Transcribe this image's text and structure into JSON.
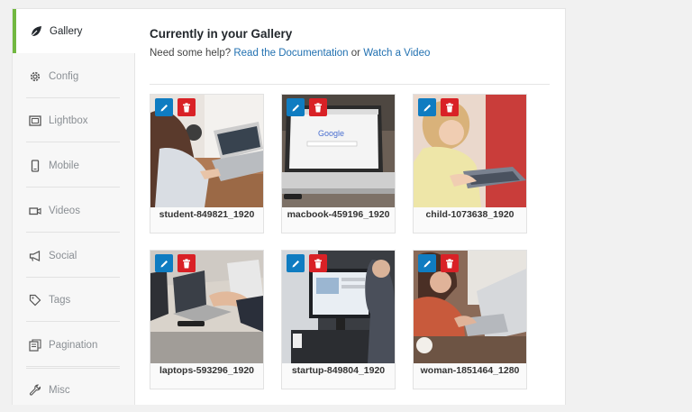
{
  "sidebar": {
    "items": [
      {
        "label": "Gallery",
        "icon": "leaf-icon",
        "active": true
      },
      {
        "label": "Config",
        "icon": "gear-icon"
      },
      {
        "label": "Lightbox",
        "icon": "lightbox-icon"
      },
      {
        "label": "Mobile",
        "icon": "mobile-icon"
      },
      {
        "label": "Videos",
        "icon": "video-camera-icon"
      },
      {
        "label": "Social",
        "icon": "megaphone-icon"
      },
      {
        "label": "Tags",
        "icon": "tag-icon"
      },
      {
        "label": "Pagination",
        "icon": "pagination-icon"
      },
      {
        "label": "Misc",
        "icon": "wrench-icon"
      }
    ]
  },
  "main": {
    "title": "Currently in your Gallery",
    "help_prefix": "Need some help?",
    "doc_link": "Read the Documentation",
    "help_or": "or",
    "video_link": "Watch a Video"
  },
  "images": [
    {
      "caption": "student-849821_1920"
    },
    {
      "caption": "macbook-459196_1920"
    },
    {
      "caption": "child-1073638_1920"
    },
    {
      "caption": "laptops-593296_1920"
    },
    {
      "caption": "startup-849804_1920"
    },
    {
      "caption": "woman-1851464_1280"
    }
  ],
  "colors": {
    "accent": "#72b841",
    "edit": "#0f7cc1",
    "delete": "#d92126",
    "link": "#2271b1"
  }
}
